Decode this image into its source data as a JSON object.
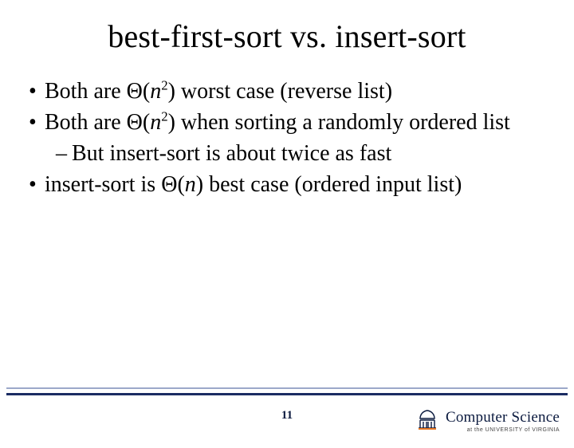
{
  "slide": {
    "title": "best-first-sort vs. insert-sort",
    "bullets": [
      {
        "pre": "Both are ",
        "sym": "Θ(",
        "var": "n",
        "exp": "2",
        "post": ") worst case (reverse list)"
      },
      {
        "pre": "Both are ",
        "sym": "Θ(",
        "var": "n",
        "exp": "2",
        "post": ") when sorting a randomly ordered list",
        "sub": "But insert-sort is about twice as fast"
      },
      {
        "pre": "insert-sort is ",
        "sym": "Θ(",
        "var": "n",
        "exp": "",
        "post": ") best case (ordered input list)"
      }
    ],
    "page_number": "11",
    "footer": {
      "brand_main": "Computer Science",
      "brand_sub": "at the UNIVERSITY of VIRGINIA"
    }
  }
}
